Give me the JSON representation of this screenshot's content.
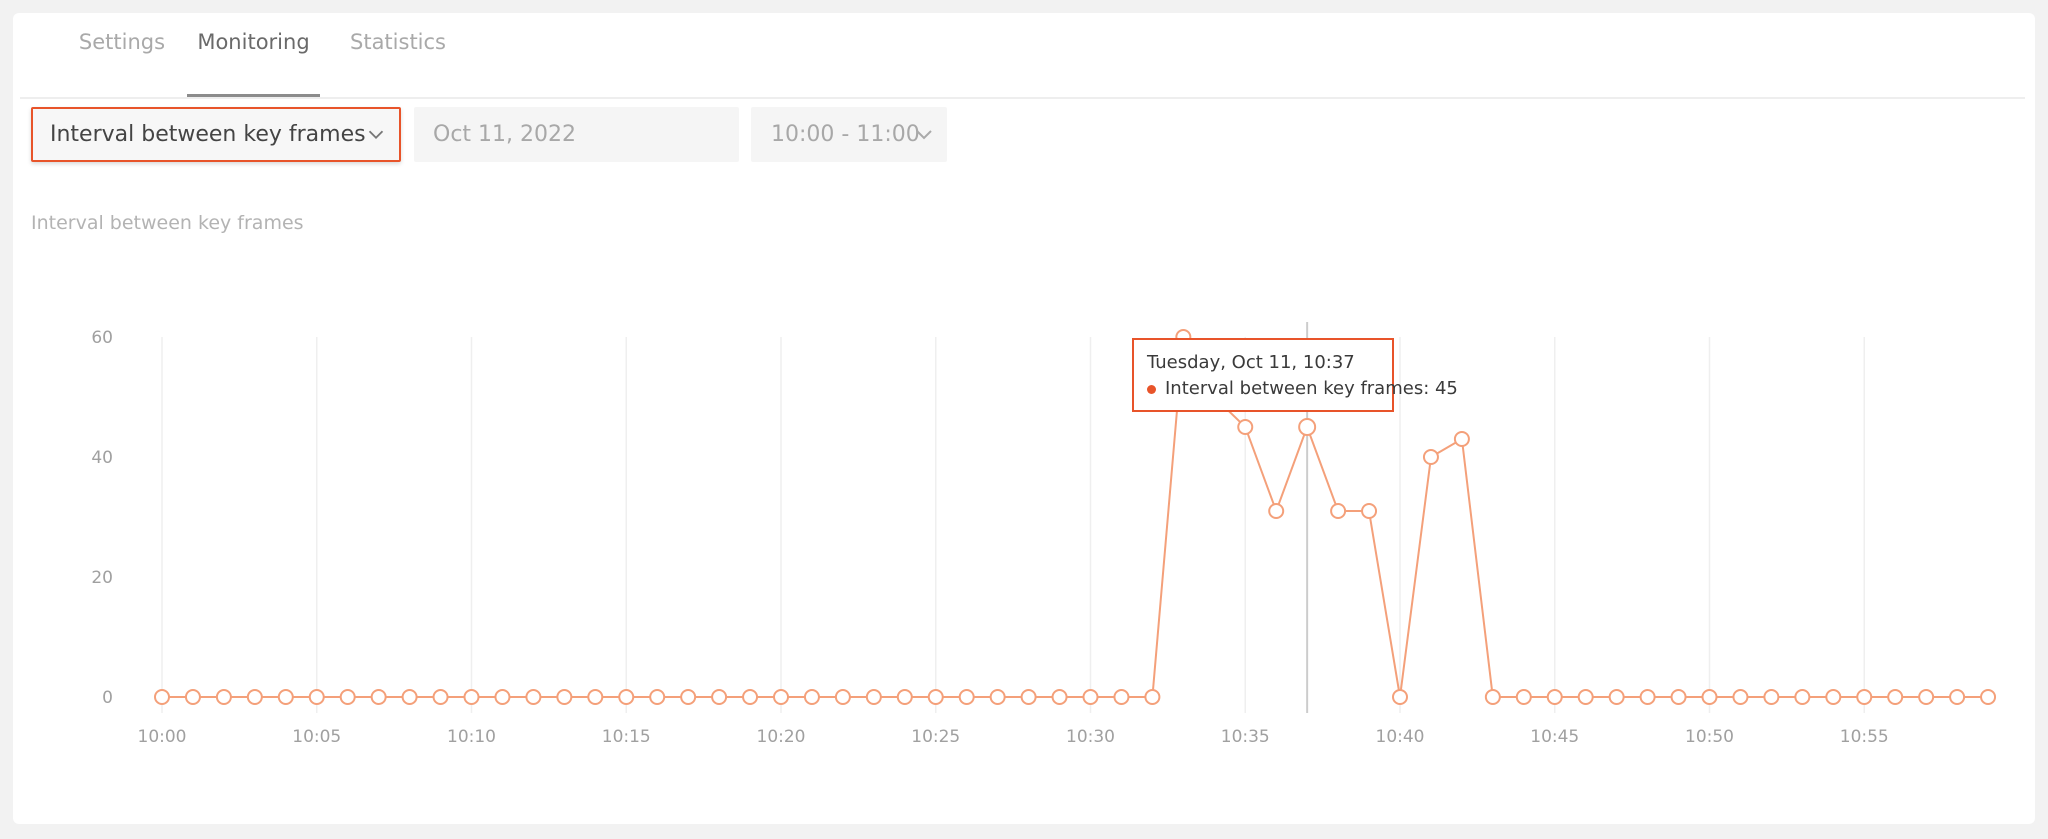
{
  "tabs": [
    {
      "label": "Settings",
      "active": false
    },
    {
      "label": "Monitoring",
      "active": true
    },
    {
      "label": "Statistics",
      "active": false
    }
  ],
  "filters": {
    "metric_select": "Interval between key frames",
    "date_field": "Oct 11, 2022",
    "time_select": "10:00 - 11:00"
  },
  "icons": {
    "dropdown": "chevron-down-icon"
  },
  "colors": {
    "accent": "#e8542a",
    "series_line": "#f4a07a",
    "grid": "#efefef",
    "hover_line": "#cccccc"
  },
  "chart_data": {
    "type": "line",
    "title": "Interval between key frames",
    "x_tick_labels": [
      "10:00",
      "10:05",
      "10:10",
      "10:15",
      "10:20",
      "10:25",
      "10:30",
      "10:35",
      "10:40",
      "10:45",
      "10:50",
      "10:55"
    ],
    "y_ticks": [
      0,
      20,
      40,
      60
    ],
    "ylim": [
      0,
      60
    ],
    "xlim_minutes": [
      0,
      59
    ],
    "grid": "vertical",
    "series": [
      {
        "name": "Interval between key frames",
        "x": [
          "10:00",
          "10:01",
          "10:02",
          "10:03",
          "10:04",
          "10:05",
          "10:06",
          "10:07",
          "10:08",
          "10:09",
          "10:10",
          "10:11",
          "10:12",
          "10:13",
          "10:14",
          "10:15",
          "10:16",
          "10:17",
          "10:18",
          "10:19",
          "10:20",
          "10:21",
          "10:22",
          "10:23",
          "10:24",
          "10:25",
          "10:26",
          "10:27",
          "10:28",
          "10:29",
          "10:30",
          "10:31",
          "10:32",
          "10:33",
          "10:34",
          "10:35",
          "10:36",
          "10:37",
          "10:38",
          "10:39",
          "10:40",
          "10:41",
          "10:42",
          "10:43",
          "10:44",
          "10:45",
          "10:46",
          "10:47",
          "10:48",
          "10:49",
          "10:50",
          "10:51",
          "10:52",
          "10:53",
          "10:54",
          "10:55",
          "10:56",
          "10:57",
          "10:58",
          "10:59"
        ],
        "values": [
          0,
          0,
          0,
          0,
          0,
          0,
          0,
          0,
          0,
          0,
          0,
          0,
          0,
          0,
          0,
          0,
          0,
          0,
          0,
          0,
          0,
          0,
          0,
          0,
          0,
          0,
          0,
          0,
          0,
          0,
          0,
          0,
          0,
          60,
          50,
          45,
          31,
          45,
          31,
          31,
          0,
          40,
          43,
          0,
          0,
          0,
          0,
          0,
          0,
          0,
          0,
          0,
          0,
          0,
          0,
          0,
          0,
          0,
          0,
          0
        ]
      }
    ],
    "tooltip": {
      "title": "Tuesday, Oct 11, 10:37",
      "label": "Interval between key frames",
      "value": 45,
      "text": "Interval between key frames: 45"
    },
    "hover_x": "10:37"
  }
}
